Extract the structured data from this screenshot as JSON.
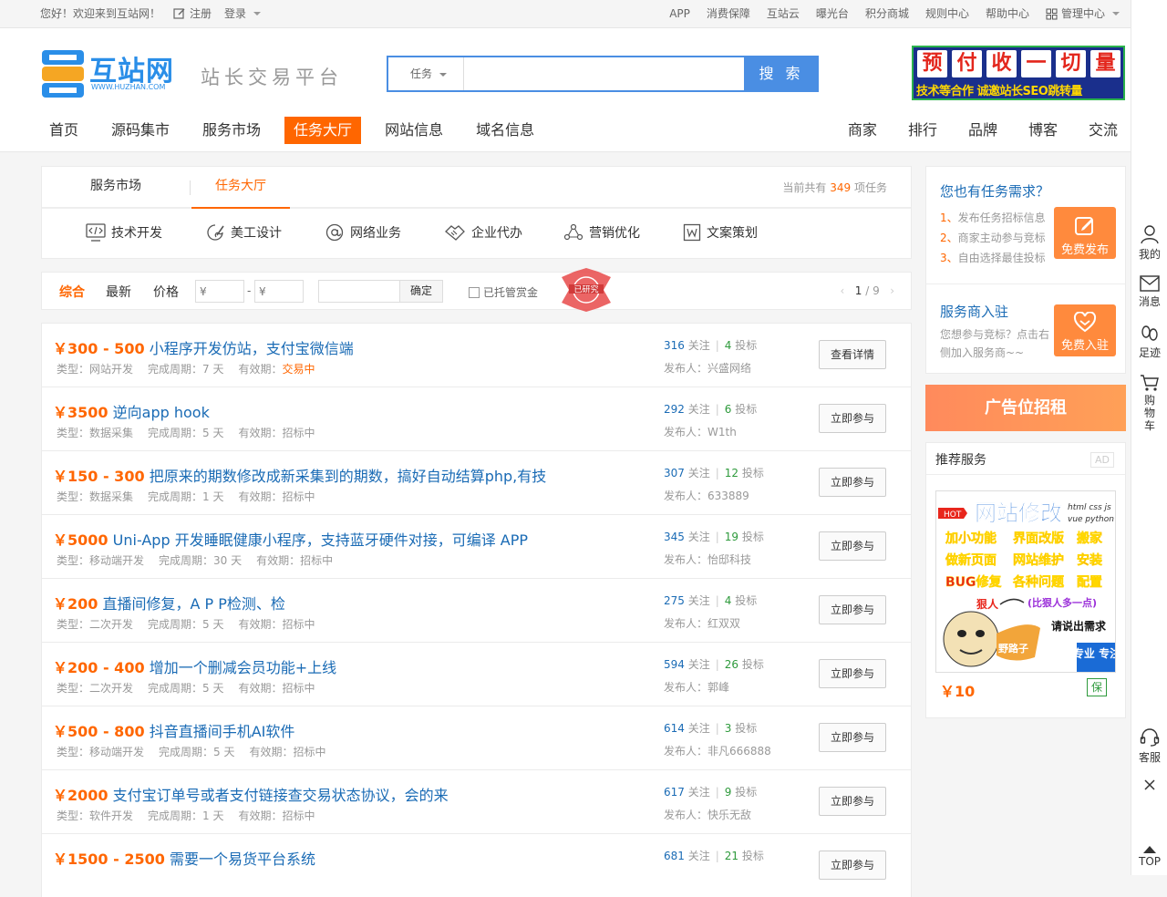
{
  "topbar": {
    "welcome": "您好！欢迎来到互站网！",
    "register": "注册",
    "login": "登录",
    "links": [
      "APP",
      "消费保障",
      "互站云",
      "曝光台",
      "积分商城",
      "规则中心",
      "帮助中心"
    ],
    "manage": "管理中心"
  },
  "header": {
    "logo_text": "互站网",
    "logo_domain": "WWW.HUZHAN.COM",
    "slogan": "站长交易平台",
    "search_category": "任务",
    "search_value": "",
    "search_button": "搜 索",
    "banner_chars": [
      "预",
      "付",
      "收",
      "一",
      "切",
      "量"
    ],
    "banner_sub": "技术等合作 诚邀站长SEO跳转量"
  },
  "nav": {
    "main": [
      "首页",
      "源码集市",
      "服务市场",
      "任务大厅",
      "网站信息",
      "域名信息"
    ],
    "active": "任务大厅",
    "right": [
      "商家",
      "排行",
      "品牌",
      "博客",
      "交流"
    ]
  },
  "tabs": {
    "service": "服务市场",
    "task": "任务大厅",
    "count_prefix": "当前共有",
    "count": "349",
    "count_suffix": "项任务",
    "categories": [
      {
        "label": "技术开发",
        "icon": "code-icon"
      },
      {
        "label": "美工设计",
        "icon": "design-icon"
      },
      {
        "label": "网络业务",
        "icon": "at-icon"
      },
      {
        "label": "企业代办",
        "icon": "handshake-icon"
      },
      {
        "label": "营销优化",
        "icon": "network-icon"
      },
      {
        "label": "文案策划",
        "icon": "document-icon"
      }
    ]
  },
  "filter": {
    "sorts": [
      "综合",
      "最新",
      "价格"
    ],
    "price_min_placeholder": "¥",
    "price_max_placeholder": "¥",
    "dash": "-",
    "confirm": "确定",
    "escrow_label": "已托管赏金",
    "escrow_checked": false,
    "seal_text": "已研究",
    "page_current": "1",
    "page_total": "/ 9"
  },
  "tasks": [
    {
      "price": "￥300 - 500",
      "title": "小程序开发仿站，支付宝微信端",
      "type": "类型：网站开发",
      "period": "完成周期：7 天",
      "valid_label": "有效期：",
      "status": "交易中",
      "follows": "316",
      "follow_label": "关注",
      "bids": "4",
      "bid_label": "投标",
      "publisher": "发布人：兴盛网络",
      "action": "查看详情"
    },
    {
      "price": "￥3500",
      "title": "逆向app hook",
      "type": "类型：数据采集",
      "period": "完成周期：5 天",
      "valid_label": "有效期：",
      "status": "招标中",
      "follows": "292",
      "follow_label": "关注",
      "bids": "6",
      "bid_label": "投标",
      "publisher": "发布人：W1th",
      "action": "立即参与"
    },
    {
      "price": "￥150 - 300",
      "title": "把原来的期数修改成新采集到的期数，搞好自动结算php,有技",
      "type": "类型：数据采集",
      "period": "完成周期：1 天",
      "valid_label": "有效期：",
      "status": "招标中",
      "follows": "307",
      "follow_label": "关注",
      "bids": "12",
      "bid_label": "投标",
      "publisher": "发布人：633889",
      "action": "立即参与"
    },
    {
      "price": "￥5000",
      "title": "Uni-App 开发睡眠健康小程序，支持蓝牙硬件对接，可编译 APP",
      "type": "类型：移动端开发",
      "period": "完成周期：30 天",
      "valid_label": "有效期：",
      "status": "招标中",
      "follows": "345",
      "follow_label": "关注",
      "bids": "19",
      "bid_label": "投标",
      "publisher": "发布人：怡邸科技",
      "action": "立即参与"
    },
    {
      "price": "￥200",
      "title": "直播间修复，A P P检测、检",
      "type": "类型：二次开发",
      "period": "完成周期：5 天",
      "valid_label": "有效期：",
      "status": "招标中",
      "follows": "275",
      "follow_label": "关注",
      "bids": "4",
      "bid_label": "投标",
      "publisher": "发布人：红双双",
      "action": "立即参与"
    },
    {
      "price": "￥200 - 400",
      "title": "增加一个删减会员功能+上线",
      "type": "类型：二次开发",
      "period": "完成周期：5 天",
      "valid_label": "有效期：",
      "status": "招标中",
      "follows": "594",
      "follow_label": "关注",
      "bids": "26",
      "bid_label": "投标",
      "publisher": "发布人：郭峰",
      "action": "立即参与"
    },
    {
      "price": "￥500 - 800",
      "title": "抖音直播间手机AI软件",
      "type": "类型：移动端开发",
      "period": "完成周期：5 天",
      "valid_label": "有效期：",
      "status": "招标中",
      "follows": "614",
      "follow_label": "关注",
      "bids": "3",
      "bid_label": "投标",
      "publisher": "发布人：非凡666888",
      "action": "立即参与"
    },
    {
      "price": "￥2000",
      "title": "支付宝订单号或者支付链接查交易状态协议，会的来",
      "type": "类型：软件开发",
      "period": "完成周期：1 天",
      "valid_label": "有效期：",
      "status": "招标中",
      "follows": "617",
      "follow_label": "关注",
      "bids": "9",
      "bid_label": "投标",
      "publisher": "发布人：快乐无敌",
      "action": "立即参与"
    },
    {
      "price": "￥1500 - 2500",
      "title": "需要一个易货平台系统",
      "type": "",
      "period": "",
      "valid_label": "",
      "status": "",
      "follows": "681",
      "follow_label": "关注",
      "bids": "21",
      "bid_label": "投标",
      "publisher": "",
      "action": "立即参与"
    }
  ],
  "sidebar": {
    "need_title": "您也有任务需求？",
    "steps": [
      {
        "num": "1、",
        "text": "发布任务招标信息"
      },
      {
        "num": "2、",
        "text": "商家主动参与竞标"
      },
      {
        "num": "3、",
        "text": "自由选择最佳投标"
      }
    ],
    "publish_btn": "免费发布",
    "join_title": "服务商入驻",
    "join_desc": "您想参与竞标？点击右侧加入服务商~~",
    "join_btn": "免费入驻",
    "ad_rent": "广告位招租",
    "rec_title": "推荐服务",
    "rec_ad": "AD",
    "rec_img": {
      "hot": "HOT",
      "headline": "网站修改",
      "tags": [
        "html css js",
        "vue python"
      ],
      "lines": [
        "加小功能",
        "界面改版",
        "搬家",
        "做新页面",
        "网站维护",
        "安装",
        "BUG修复",
        "各种问题",
        "配置"
      ],
      "caption1": "狠人",
      "caption2": "(比狠人多一点)",
      "caption3": "请说出需求",
      "caption4": "野路子",
      "badge": "专业 专注"
    },
    "rec_price": "￥10",
    "rec_badge": "保"
  },
  "rail": [
    {
      "label": "我的",
      "icon": "user-icon"
    },
    {
      "label": "消息",
      "icon": "mail-icon"
    },
    {
      "label": "足迹",
      "icon": "footprint-icon"
    },
    {
      "label": "购物车",
      "icon": "cart-icon"
    },
    {
      "label": "客服",
      "icon": "headset-icon"
    },
    {
      "label": "TOP",
      "icon": "up-arrow-icon"
    }
  ]
}
